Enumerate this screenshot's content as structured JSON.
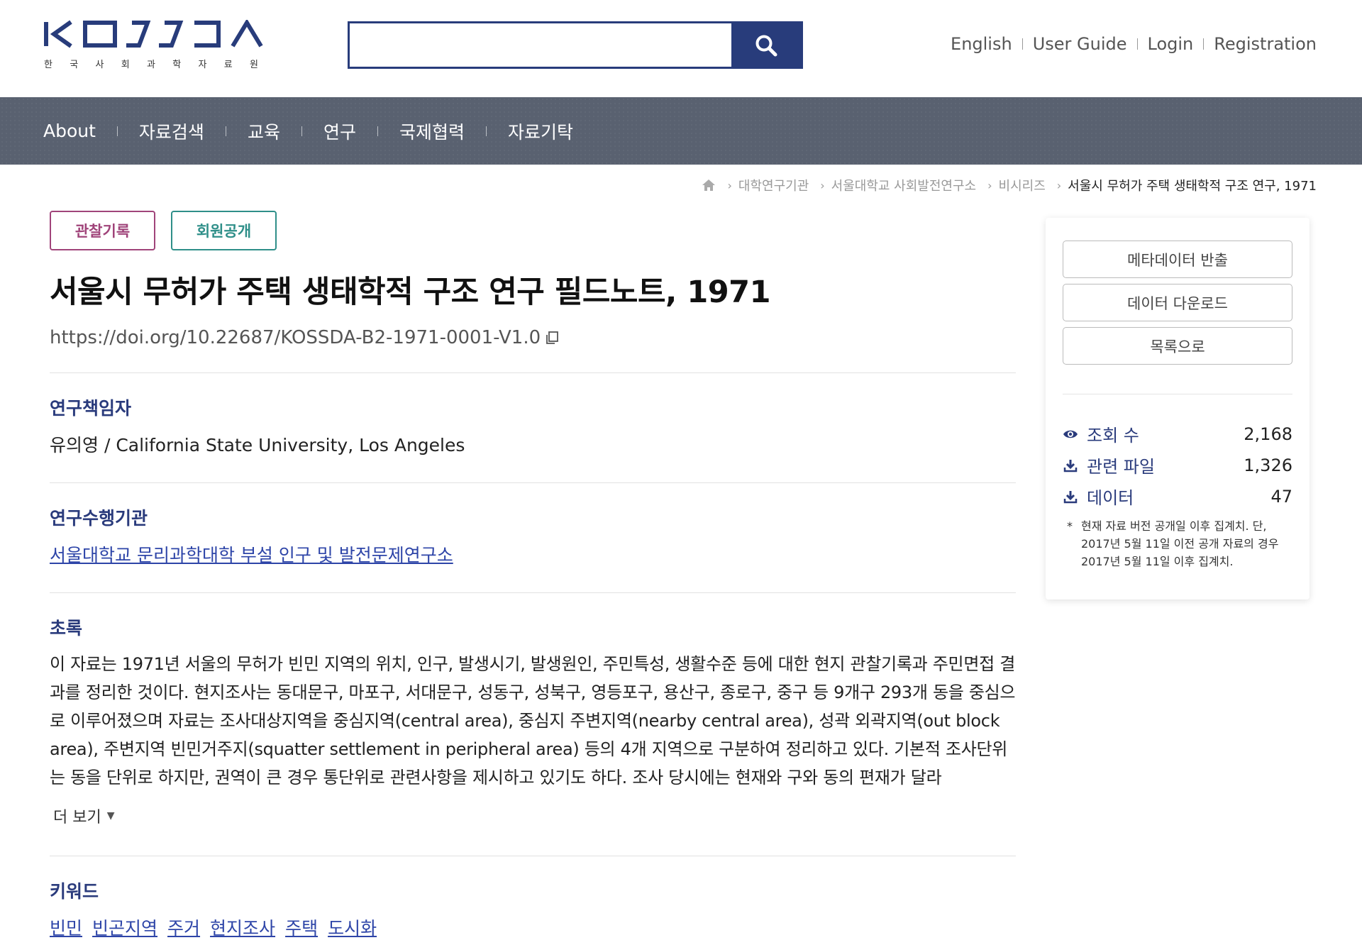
{
  "header": {
    "logo_text": "KOSSDA",
    "logo_subtitle": [
      "한",
      "국",
      "사",
      "회",
      "과",
      "학",
      "자",
      "료",
      "원"
    ],
    "search": {
      "placeholder": "",
      "value": ""
    },
    "util_links": [
      "English",
      "User Guide",
      "Login",
      "Registration"
    ]
  },
  "nav": {
    "items": [
      "About",
      "자료검색",
      "교육",
      "연구",
      "국제협력",
      "자료기탁"
    ]
  },
  "breadcrumb": {
    "items": [
      "대학연구기관",
      "서울대학교 사회발전연구소",
      "비시리즈"
    ],
    "current": "서울시 무허가 주택 생태학적 구조 연구, 1971"
  },
  "main": {
    "badges": [
      "관찰기록",
      "회원공개"
    ],
    "title": "서울시 무허가 주택 생태학적 구조 연구 필드노트, 1971",
    "doi": "https://doi.org/10.22687/KOSSDA-B2-1971-0001-V1.0",
    "pi": {
      "label": "연구책임자",
      "value": "유의영 / California State University, Los Angeles"
    },
    "institution": {
      "label": "연구수행기관",
      "value": "서울대학교 문리과학대학 부설 인구 및 발전문제연구소"
    },
    "abstract": {
      "label": "초록",
      "text": "이 자료는 1971년 서울의 무허가 빈민 지역의 위치, 인구, 발생시기, 발생원인, 주민특성, 생활수준 등에 대한 현지 관찰기록과 주민면접 결과를 정리한 것이다. 현지조사는 동대문구, 마포구, 서대문구, 성동구, 성북구, 영등포구, 용산구, 종로구, 중구 등 9개구 293개 동을 중심으로 이루어졌으며 자료는 조사대상지역을 중심지역(central area), 중심지 주변지역(nearby central area), 성곽 외곽지역(out block area), 주변지역 빈민거주지(squatter settlement in peripheral area) 등의 4개 지역으로 구분하여 정리하고 있다. 기본적 조사단위는 동을 단위로 하지만, 권역이 큰 경우 통단위로 관련사항을 제시하고 있기도 하다. 조사 당시에는 현재와 구와 동의 편재가 달라",
      "more_label": "더 보기"
    },
    "keywords": {
      "label": "키워드",
      "items": [
        "빈민",
        "빈곤지역",
        "주거",
        "현지조사",
        "주택",
        "도시화"
      ]
    }
  },
  "sidebar": {
    "buttons": [
      "메타데이터 반출",
      "데이터 다운로드",
      "목록으로"
    ],
    "stats": [
      {
        "label": "조회 수",
        "value": "2,168",
        "icon": "eye-icon"
      },
      {
        "label": "관련 파일",
        "value": "1,326",
        "icon": "download-icon"
      },
      {
        "label": "데이터",
        "value": "47",
        "icon": "download-icon"
      }
    ],
    "note": "현재 자료 버전 공개일 이후 집계치. 단, 2017년 5월 11일 이전 공개 자료의 경우 2017년 5월 11일 이후 집계치.",
    "note_star": "*"
  },
  "colors": {
    "brand_navy": "#283c7b",
    "nav_bg": "#596170",
    "badge_observation": "#a0447a",
    "badge_member": "#2f8f89",
    "link": "#2e45a8"
  }
}
